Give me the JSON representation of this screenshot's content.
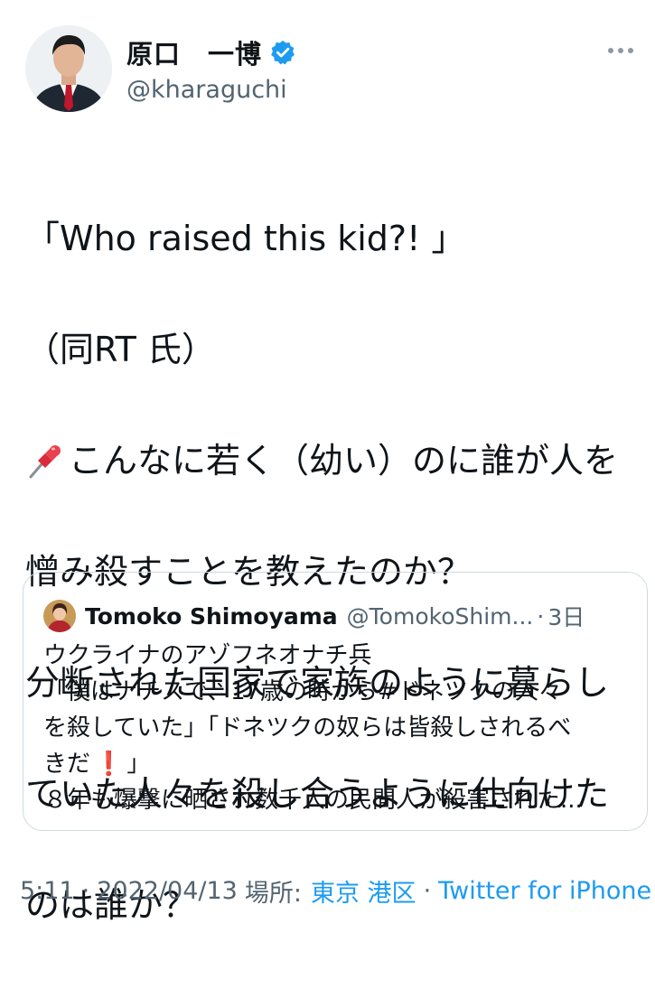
{
  "author": {
    "display_name": "原口　一博",
    "handle": "@kharaguchi",
    "verified": true
  },
  "tweet": {
    "lines": [
      "「Who raised this kid?! 」",
      "（同RT 氏）",
      "こんなに若く（幼い）のに誰が人を",
      "憎み殺すことを教えたのか？",
      "分断された国家で家族のように暮らし",
      "ていた人々を殺し合うように仕向けた",
      "のは誰か？"
    ],
    "pin_icon": "pushpin-icon"
  },
  "quoted": {
    "name": "Tomoko Shimoyama",
    "handle": "@TomokoShim...",
    "separator": "·",
    "time": "3日",
    "lines": {
      "l1": "ウクライナのアゾフネオナチ兵",
      "l2a": "「僕はナチスで、17歳の時から ",
      "l2b": "#ドネツク",
      "l2c": " の人々",
      "l3": "を殺していた」「ドネツクの奴らは皆殺しされるべ",
      "l4a": "きだ",
      "l4b": "❗",
      "l4c": "」",
      "l5": "８年も爆撃に晒され数千人の民間人が殺害された..."
    }
  },
  "meta": {
    "time": "5:11",
    "dot1": "·",
    "date": "2022/04/13",
    "location_label": "場所:",
    "location": "東京 港区",
    "dot2": "·",
    "source": "Twitter for iPhone"
  },
  "colors": {
    "verified_blue": "#1d9bf0",
    "link_blue": "#1d9bf0",
    "secondary_gray": "#536471"
  }
}
